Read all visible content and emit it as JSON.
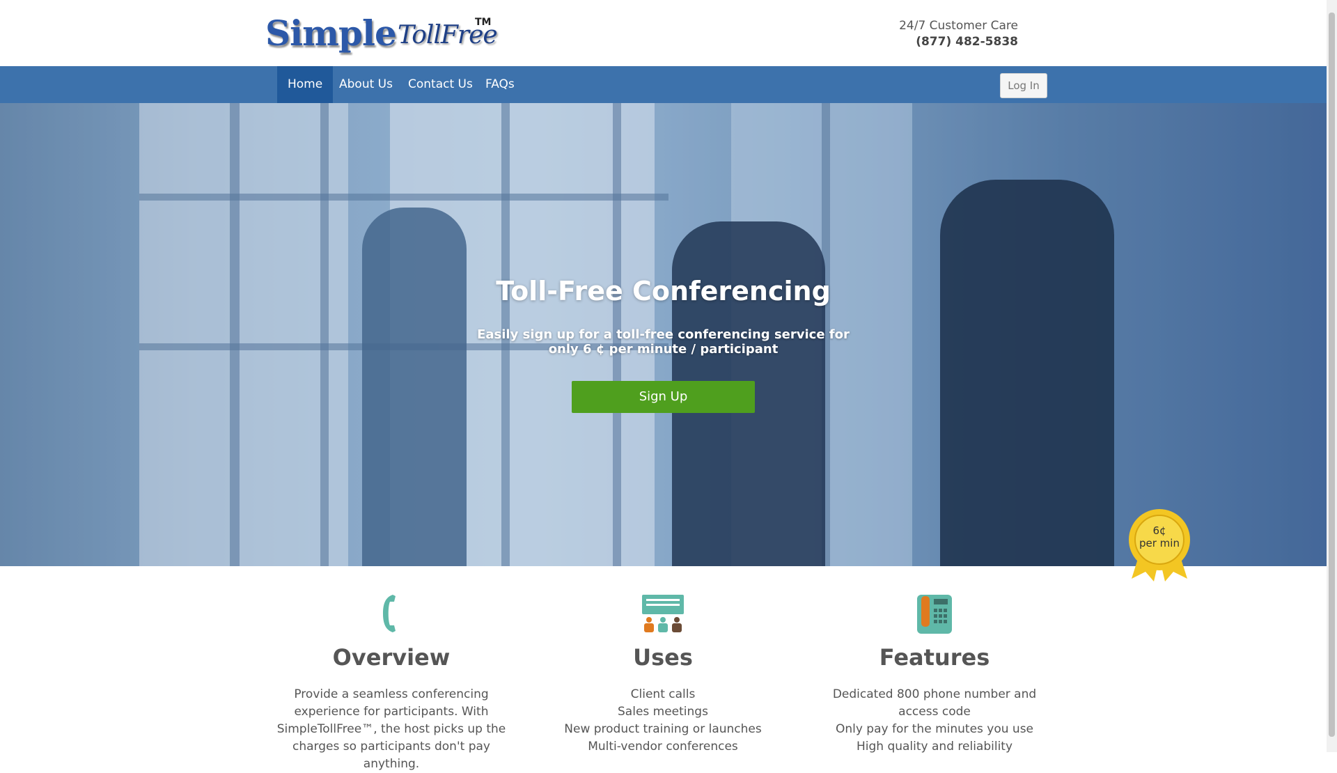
{
  "header": {
    "logo_main": "Simple",
    "logo_secondary": "TollFree",
    "logo_tm": "TM",
    "care_label": "24/7 Customer Care",
    "care_phone": "(877) 482-5838"
  },
  "nav": {
    "items": [
      {
        "label": "Home",
        "active": true
      },
      {
        "label": "About Us",
        "active": false
      },
      {
        "label": "Contact Us",
        "active": false
      },
      {
        "label": "FAQs",
        "active": false
      }
    ],
    "login_label": "Log In"
  },
  "hero": {
    "title": "Toll-Free Conferencing",
    "subtitle": "Easily sign up for a toll-free conferencing service for only 6 ¢ per minute / participant",
    "signup_label": "Sign Up",
    "badge_price": "6¢",
    "badge_unit": "per min"
  },
  "columns": [
    {
      "icon": "phone-handset-icon",
      "title": "Overview",
      "lines": [
        "Provide a seamless conferencing experience for participants. With SimpleTollFree™, the host picks up the charges so participants don't pay anything."
      ]
    },
    {
      "icon": "meeting-people-icon",
      "title": "Uses",
      "lines": [
        "Client calls",
        "Sales meetings",
        "New product training or launches",
        "Multi-vendor conferences"
      ]
    },
    {
      "icon": "desk-phone-icon",
      "title": "Features",
      "lines": [
        "Dedicated 800 phone number and access code",
        "Only pay for the minutes you use",
        "High quality and reliability"
      ]
    }
  ],
  "colors": {
    "nav_bg": "#3d72ac",
    "nav_active": "#20599a",
    "signup_green": "#4f9f1e",
    "badge_gold": "#f3c623",
    "icon_teal": "#5fb8a8",
    "icon_orange": "#e07a1f"
  }
}
